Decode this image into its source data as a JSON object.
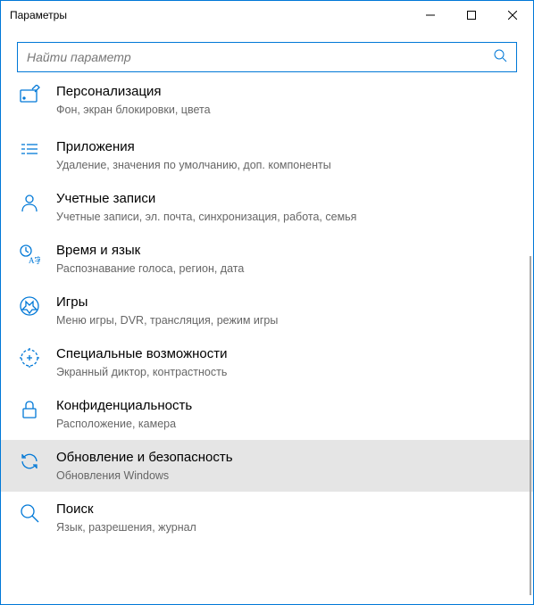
{
  "window": {
    "title": "Параметры"
  },
  "search": {
    "placeholder": "Найти параметр"
  },
  "items": [
    {
      "title": "Персонализация",
      "subtitle": "Фон, экран блокировки, цвета"
    },
    {
      "title": "Приложения",
      "subtitle": "Удаление, значения по умолчанию, доп. компоненты"
    },
    {
      "title": "Учетные записи",
      "subtitle": "Учетные записи, эл. почта, синхронизация, работа, семья"
    },
    {
      "title": "Время и язык",
      "subtitle": "Распознавание голоса, регион, дата"
    },
    {
      "title": "Игры",
      "subtitle": "Меню игры, DVR, трансляция, режим игры"
    },
    {
      "title": "Специальные возможности",
      "subtitle": "Экранный диктор, контрастность"
    },
    {
      "title": "Конфиденциальность",
      "subtitle": "Расположение, камера"
    },
    {
      "title": "Обновление и безопасность",
      "subtitle": "Обновления Windows"
    },
    {
      "title": "Поиск",
      "subtitle": "Язык, разрешения, журнал"
    }
  ]
}
